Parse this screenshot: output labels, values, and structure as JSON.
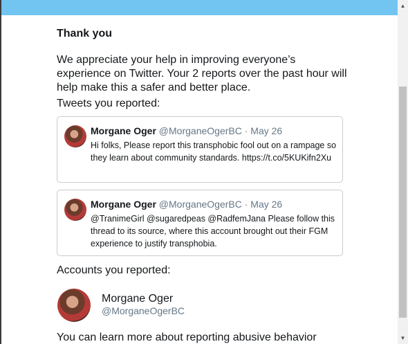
{
  "dialog": {
    "title": "Thank you",
    "message": "We appreciate your help in improving everyone’s experience on Twitter. Your 2 reports over the past hour will help make this a safer and better place.",
    "tweets_label": "Tweets you reported:",
    "accounts_label": "Accounts you reported:",
    "footer_text": "You can learn more about reporting abusive behavior"
  },
  "tweets": [
    {
      "name": "Morgane Oger",
      "handle": "@MorganeOgerBC",
      "separator": "·",
      "date": "May 26",
      "text": "Hi folks, Please report this transphobic fool out on a rampage so they learn about community standards. https://t.co/5KUKifn2Xu"
    },
    {
      "name": "Morgane Oger",
      "handle": "@MorganeOgerBC",
      "separator": "·",
      "date": "May 26",
      "text": "@TranimeGirl @sugaredpeas @RadfemJana Please follow this thread to its source, where this account brought out their FGM experience to justify transphobia."
    }
  ],
  "account": {
    "name": "Morgane Oger",
    "handle": "@MorganeOgerBC"
  },
  "scrollbar": {
    "up_glyph": "▲",
    "down_glyph": "▼"
  },
  "colors": {
    "topbar": "#72c4f1",
    "text": "#14171a",
    "muted": "#657786",
    "card_border": "#c7cdd2"
  }
}
